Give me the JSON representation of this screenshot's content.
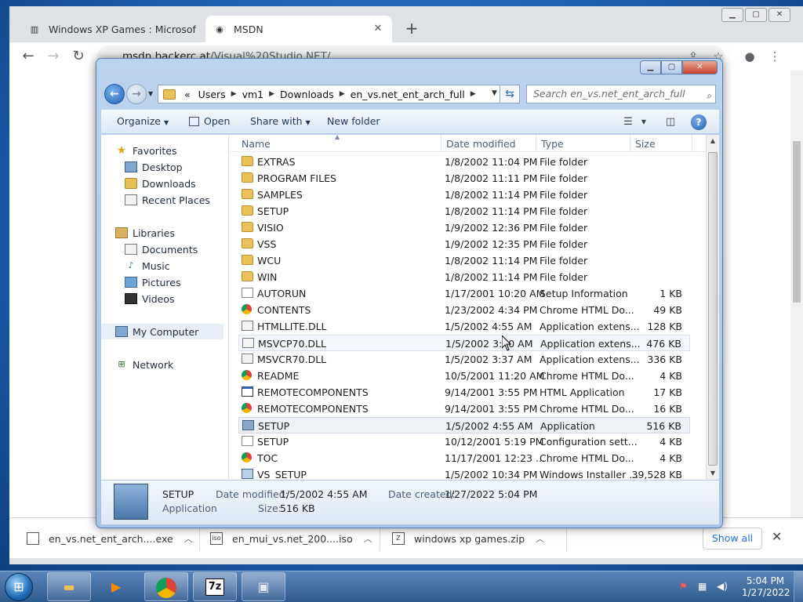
{
  "chrome": {
    "tabs": [
      {
        "label": "Windows XP Games : Microsoft C",
        "icon": "archive-icon"
      },
      {
        "label": "MSDN",
        "icon": "globe-icon"
      }
    ],
    "url_prefix": "msdn.backerc.at",
    "url_path": "/Visual%20Studio.NET/",
    "downloads": [
      {
        "name": "en_vs.net_ent_arch....exe"
      },
      {
        "name": "en_mui_vs.net_200....iso"
      },
      {
        "name": "windows xp games.zip"
      }
    ],
    "show_all": "Show all"
  },
  "explorer": {
    "breadcrumb": [
      "Users",
      "vm1",
      "Downloads",
      "en_vs.net_ent_arch_full"
    ],
    "crumb_prefix": "«",
    "search_placeholder": "Search en_vs.net_ent_arch_full",
    "commands": {
      "organize": "Organize",
      "open": "Open",
      "share_with": "Share with",
      "new_folder": "New folder"
    },
    "nav": {
      "favorites": "Favorites",
      "desktop": "Desktop",
      "downloads": "Downloads",
      "recent": "Recent Places",
      "libraries": "Libraries",
      "documents": "Documents",
      "music": "Music",
      "pictures": "Pictures",
      "videos": "Videos",
      "computer": "My Computer",
      "network": "Network"
    },
    "columns": {
      "name": "Name",
      "date": "Date modified",
      "type": "Type",
      "size": "Size"
    },
    "files": [
      {
        "name": "EXTRAS",
        "date": "1/8/2002 11:04 PM",
        "type": "File folder",
        "size": "",
        "icon": "folder"
      },
      {
        "name": "PROGRAM FILES",
        "date": "1/8/2002 11:11 PM",
        "type": "File folder",
        "size": "",
        "icon": "folder"
      },
      {
        "name": "SAMPLES",
        "date": "1/8/2002 11:14 PM",
        "type": "File folder",
        "size": "",
        "icon": "folder"
      },
      {
        "name": "SETUP",
        "date": "1/8/2002 11:14 PM",
        "type": "File folder",
        "size": "",
        "icon": "folder"
      },
      {
        "name": "VISIO",
        "date": "1/9/2002 12:36 PM",
        "type": "File folder",
        "size": "",
        "icon": "folder"
      },
      {
        "name": "VSS",
        "date": "1/9/2002 12:35 PM",
        "type": "File folder",
        "size": "",
        "icon": "folder"
      },
      {
        "name": "WCU",
        "date": "1/8/2002 11:14 PM",
        "type": "File folder",
        "size": "",
        "icon": "folder"
      },
      {
        "name": "WIN",
        "date": "1/8/2002 11:14 PM",
        "type": "File folder",
        "size": "",
        "icon": "folder"
      },
      {
        "name": "AUTORUN",
        "date": "1/17/2001 10:20 AM",
        "type": "Setup Information",
        "size": "1 KB",
        "icon": "ini"
      },
      {
        "name": "CONTENTS",
        "date": "1/23/2002 4:34 PM",
        "type": "Chrome HTML Do...",
        "size": "49 KB",
        "icon": "chrome"
      },
      {
        "name": "HTMLLITE.DLL",
        "date": "1/5/2002 4:55 AM",
        "type": "Application extens...",
        "size": "128 KB",
        "icon": "dll"
      },
      {
        "name": "MSVCP70.DLL",
        "date": "1/5/2002 3:40 AM",
        "type": "Application extens...",
        "size": "476 KB",
        "icon": "dll"
      },
      {
        "name": "MSVCR70.DLL",
        "date": "1/5/2002 3:37 AM",
        "type": "Application extens...",
        "size": "336 KB",
        "icon": "dll"
      },
      {
        "name": "README",
        "date": "10/5/2001 11:20 AM",
        "type": "Chrome HTML Do...",
        "size": "4 KB",
        "icon": "chrome"
      },
      {
        "name": "REMOTECOMPONENTS",
        "date": "9/14/2001 3:55 PM",
        "type": "HTML Application",
        "size": "17 KB",
        "icon": "hta"
      },
      {
        "name": "REMOTECOMPONENTS",
        "date": "9/14/2001 3:55 PM",
        "type": "Chrome HTML Do...",
        "size": "16 KB",
        "icon": "chrome"
      },
      {
        "name": "SETUP",
        "date": "1/5/2002 4:55 AM",
        "type": "Application",
        "size": "516 KB",
        "icon": "exe"
      },
      {
        "name": "SETUP",
        "date": "10/12/2001 5:19 PM",
        "type": "Configuration sett...",
        "size": "4 KB",
        "icon": "ini"
      },
      {
        "name": "TOC",
        "date": "11/17/2001 12:23 ...",
        "type": "Chrome HTML Do...",
        "size": "4 KB",
        "icon": "chrome"
      },
      {
        "name": "VS_SETUP",
        "date": "1/5/2002 10:34 PM",
        "type": "Windows Installer ...",
        "size": "39,528 KB",
        "icon": "msi"
      }
    ],
    "details": {
      "name": "SETUP",
      "kind": "Application",
      "date_modified_label": "Date modified:",
      "date_modified": "1/5/2002 4:55 AM",
      "date_created_label": "Date created:",
      "date_created": "1/27/2022 5:04 PM",
      "size_label": "Size:",
      "size": "516 KB"
    }
  },
  "taskbar": {
    "time": "5:04 PM",
    "date": "1/27/2022",
    "apps": [
      "explorer",
      "media-player",
      "chrome",
      "7-zip",
      "setup"
    ],
    "seven_zip": "7z"
  }
}
